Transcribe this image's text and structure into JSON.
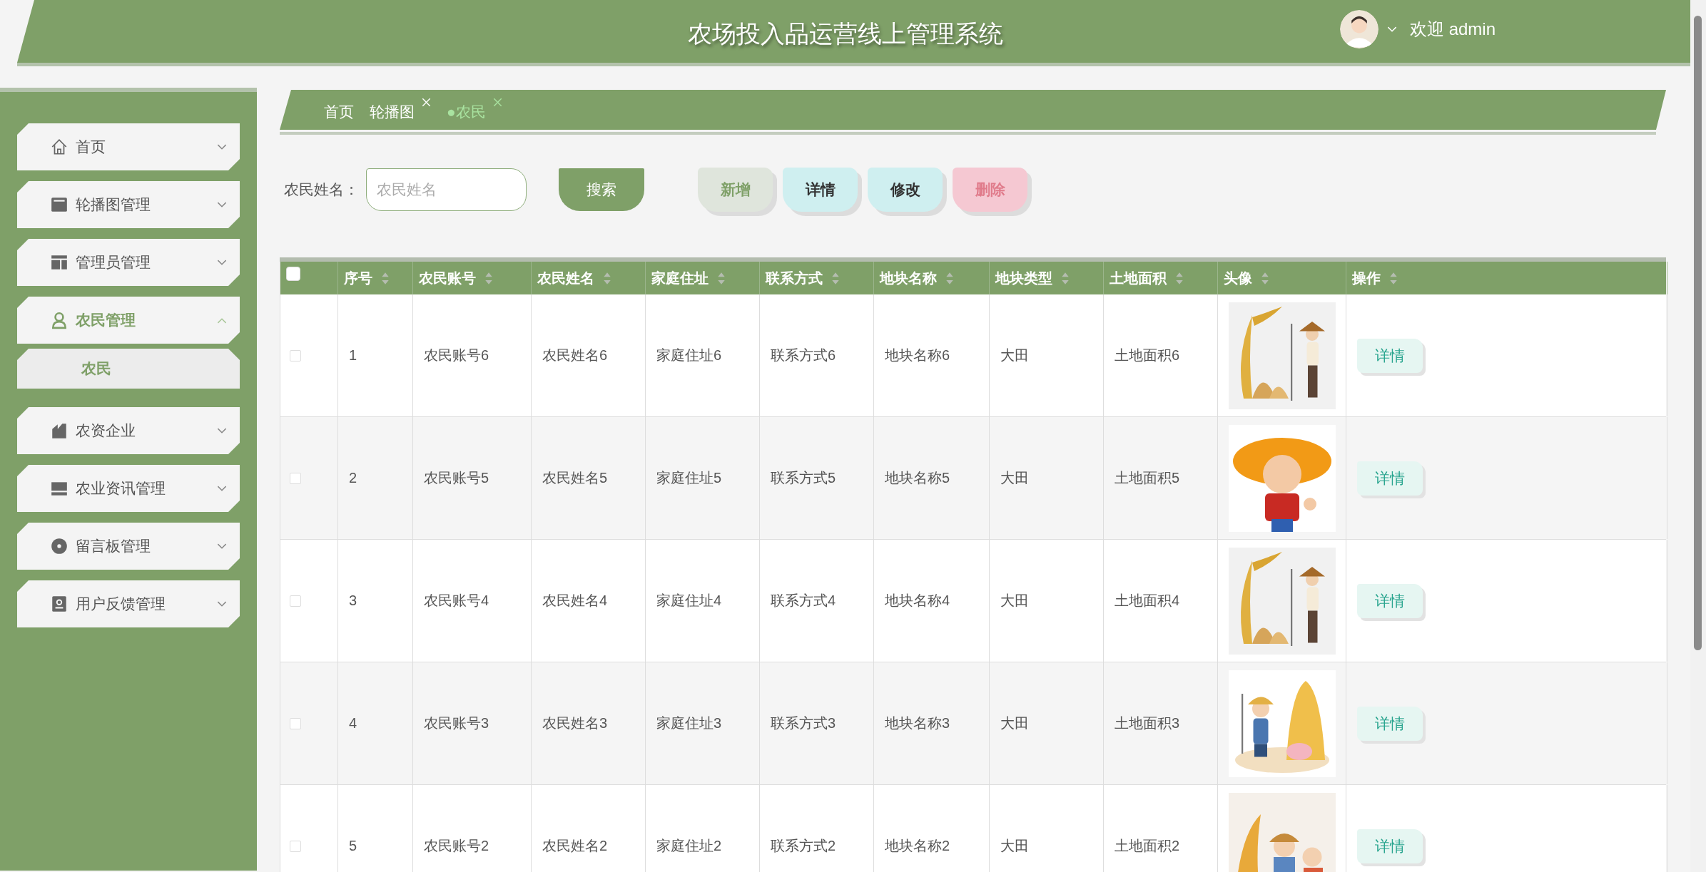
{
  "header": {
    "title": "农场投入品运营线上管理系统",
    "welcome": "欢迎 admin"
  },
  "sidebar": {
    "items": [
      {
        "label": "首页",
        "expanded": false
      },
      {
        "label": "轮播图管理",
        "expanded": false
      },
      {
        "label": "管理员管理",
        "expanded": false
      },
      {
        "label": "农民管理",
        "expanded": true,
        "children": [
          {
            "label": "农民",
            "selected": true
          }
        ]
      },
      {
        "label": "农资企业",
        "expanded": false
      },
      {
        "label": "农业资讯管理",
        "expanded": false
      },
      {
        "label": "留言板管理",
        "expanded": false
      },
      {
        "label": "用户反馈管理",
        "expanded": false
      }
    ]
  },
  "tabs": [
    {
      "label": "首页",
      "selected": false,
      "closable": false
    },
    {
      "label": "轮播图",
      "selected": false,
      "closable": true
    },
    {
      "label": "●农民",
      "selected": true,
      "closable": true
    }
  ],
  "search": {
    "label": "农民姓名：",
    "placeholder": "农民姓名",
    "button": "搜索"
  },
  "actions": [
    {
      "label": "新增",
      "kind": "add"
    },
    {
      "label": "详情",
      "kind": "detail"
    },
    {
      "label": "修改",
      "kind": "edit"
    },
    {
      "label": "删除",
      "kind": "delete"
    }
  ],
  "table": {
    "select_all": {
      "checked": false
    },
    "columns": [
      "序号",
      "农民账号",
      "农民姓名",
      "家庭住址",
      "联系方式",
      "地块名称",
      "地块类型",
      "土地面积",
      "头像",
      "操作"
    ],
    "rows": [
      {
        "selected": false,
        "cells": [
          "1",
          "农民账号6",
          "农民姓名6",
          "家庭住址6",
          "联系方式6",
          "地块名称6",
          "大田",
          "土地面积6"
        ],
        "action": "详情"
      },
      {
        "selected": false,
        "cells": [
          "2",
          "农民账号5",
          "农民姓名5",
          "家庭住址5",
          "联系方式5",
          "地块名称5",
          "大田",
          "土地面积5"
        ],
        "action": "详情"
      },
      {
        "selected": false,
        "cells": [
          "3",
          "农民账号4",
          "农民姓名4",
          "家庭住址4",
          "联系方式4",
          "地块名称4",
          "大田",
          "土地面积4"
        ],
        "action": "详情"
      },
      {
        "selected": false,
        "cells": [
          "4",
          "农民账号3",
          "农民姓名3",
          "家庭住址3",
          "联系方式3",
          "地块名称3",
          "大田",
          "土地面积3"
        ],
        "action": "详情"
      },
      {
        "selected": false,
        "cells": [
          "5",
          "农民账号2",
          "农民姓名2",
          "家庭住址2",
          "联系方式2",
          "地块名称2",
          "大田",
          "土地面积2"
        ],
        "action": "详情"
      }
    ]
  }
}
